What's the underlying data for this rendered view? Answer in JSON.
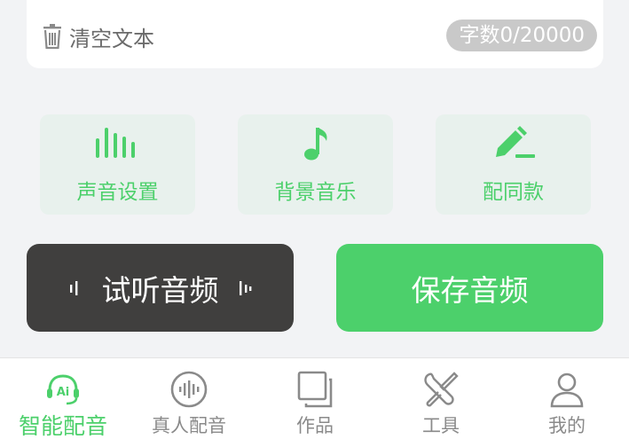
{
  "text_panel": {
    "clear_label": "清空文本",
    "count_label": "字数0/20000"
  },
  "options": [
    {
      "label": "声音设置",
      "icon": "sound-settings-icon"
    },
    {
      "label": "背景音乐",
      "icon": "music-note-icon"
    },
    {
      "label": "配同款",
      "icon": "pencil-edit-icon"
    }
  ],
  "actions": {
    "listen_label": "试听音频",
    "save_label": "保存音频"
  },
  "tabbar": {
    "active_index": 0,
    "tabs": [
      {
        "label": "智能配音",
        "icon": "ai-headset-icon"
      },
      {
        "label": "真人配音",
        "icon": "voice-wave-icon"
      },
      {
        "label": "作品",
        "icon": "works-icon"
      },
      {
        "label": "工具",
        "icon": "tools-icon"
      },
      {
        "label": "我的",
        "icon": "user-icon"
      }
    ]
  },
  "colors": {
    "accent": "#4cd06b",
    "dark_button": "#403f3e",
    "option_bg": "#e8f1ed",
    "page_bg": "#f2f3f5",
    "inactive": "#8a8a8a"
  }
}
